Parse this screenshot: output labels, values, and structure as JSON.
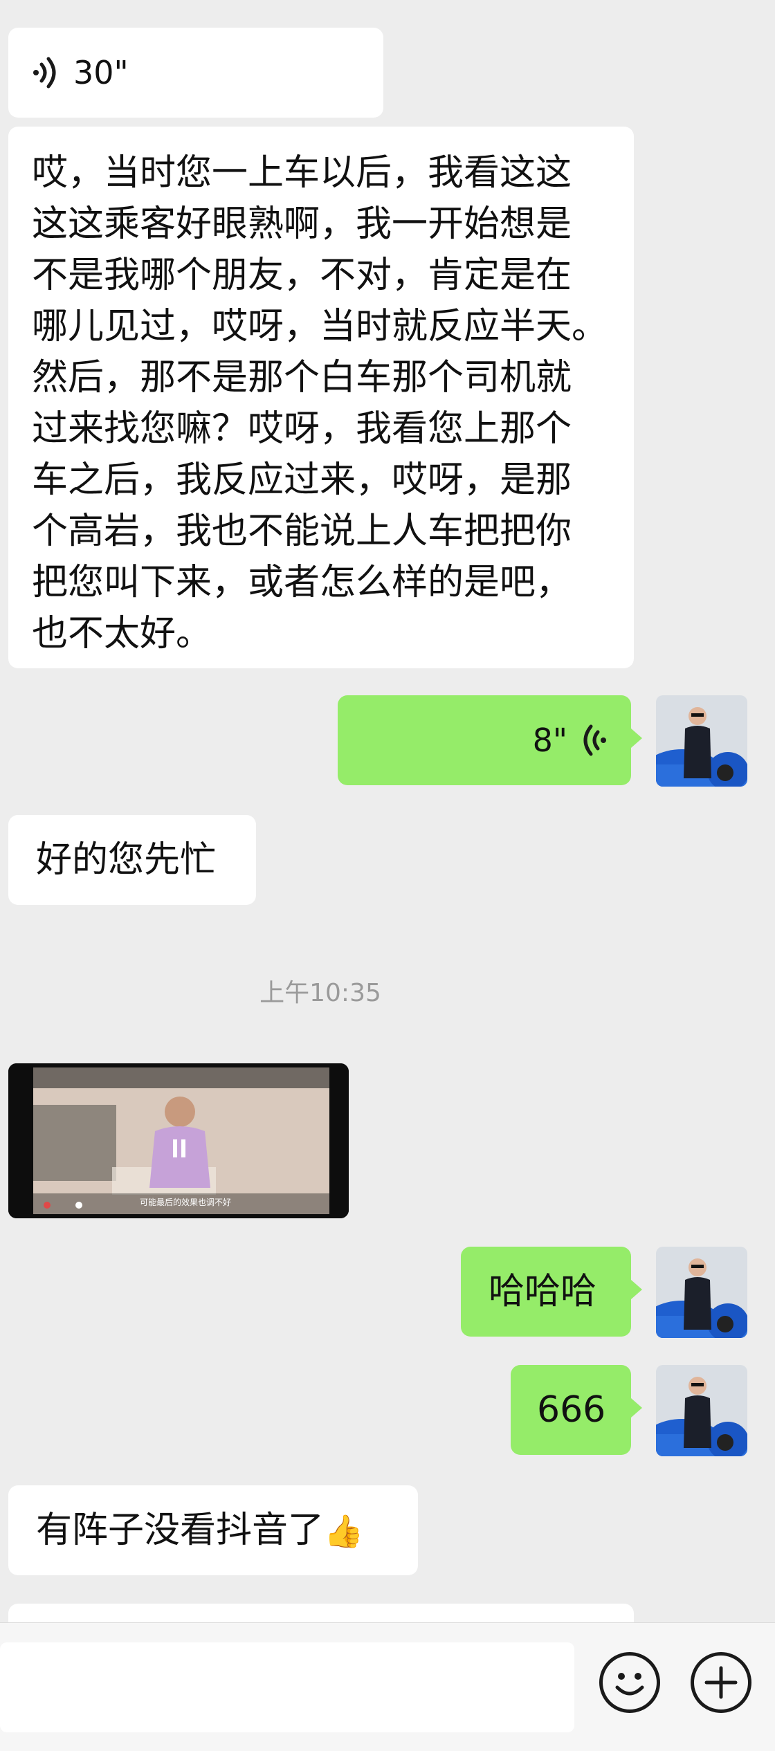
{
  "messages": {
    "voice_in_duration": "30\"",
    "long_text": [
      "哎，当时您一上车以后，我看这这",
      "这这乘客好眼熟啊，我一开始想是",
      "不是我哪个朋友，不对，肯定是在",
      "哪儿见过，哎呀，当时就反应半天。",
      "然后，那不是那个白车那个司机就",
      "过来找您嘛？哎呀，我看您上那个",
      "车之后，我反应过来，哎呀，是那",
      "个高岩，我也不能说上人车把把你",
      "把您叫下来，或者怎么样的是吧，",
      "也不太好。"
    ],
    "voice_out_duration": "8\"",
    "reply_ok": "好的您先忙",
    "timestamp": "上午10:35",
    "video_subtitle": "可能最后的效果也调不好",
    "haha": "哈哈哈",
    "six": "666",
    "douyin": "有阵子没看抖音了",
    "thumbs_emoji": "👍"
  },
  "colors": {
    "background": "#ededed",
    "incoming_bubble": "#ffffff",
    "outgoing_bubble": "#95ec69",
    "timestamp_text": "#9a9a9a"
  },
  "icons": {
    "voice_in": "voice-wave-icon",
    "voice_out": "voice-wave-icon",
    "emoji": "smiley-icon",
    "add": "plus-icon"
  }
}
